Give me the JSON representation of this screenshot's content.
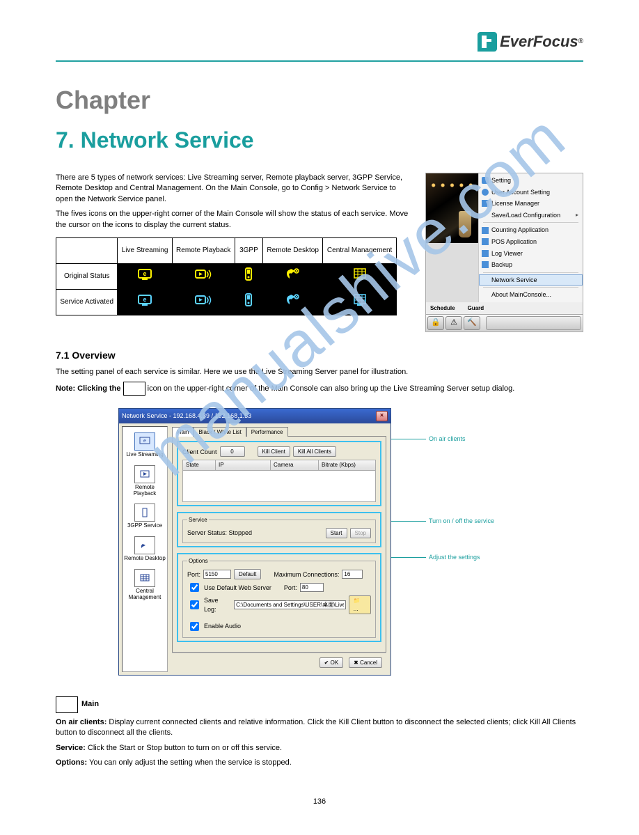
{
  "logo": {
    "brand": "EverFocus",
    "reg": "®"
  },
  "chapter_label": "Chapter",
  "chapter_title": "7. Network Service",
  "intro_para": "There are 5 types of network services: Live Streaming server, Remote playback server, 3GPP Service, Remote Desktop and Central Management. On the Main Console, go to Config > Network Service to open the Network Service panel.",
  "icon_explain": "The fives icons on the upper-right corner of the Main Console will show the status of each service. Move the cursor on the icons to display the current status.",
  "icon_table": {
    "cols": [
      "",
      "Live Streaming",
      "Remote Playback",
      "3GPP",
      "Remote Desktop",
      "Central Management"
    ],
    "rows": [
      {
        "label": "Original Status"
      },
      {
        "label": "Service Activated"
      }
    ]
  },
  "ctx": {
    "items": [
      "Setting",
      "User Account Setting",
      "License Manager",
      "Save/Load Configuration",
      "Counting Application",
      "POS Application",
      "Log Viewer",
      "Backup",
      "Network Service",
      "About MainConsole..."
    ],
    "tabs": [
      "Schedule",
      "Guard"
    ]
  },
  "overview": {
    "title": "7.1 Overview",
    "text": "The setting panel of each service is similar. Here we use the Live Streaming Server panel for illustration."
  },
  "note": "Note: Clicking the",
  "note2": "icon on the upper-right corner of the Main Console can also bring up the Live Streaming Server setup dialog.",
  "dialog": {
    "title": "Network Service - 192.168.4.39 / 192.168.1.53",
    "tabs": [
      "Main",
      "Black / White List",
      "Performance"
    ],
    "sidebar": [
      "Live Streaming",
      "Remote Playback",
      "3GPP Service",
      "Remote Desktop",
      "Central Management"
    ],
    "client_count_label": "Client Count",
    "client_count_value": "0",
    "kill_client": "Kill Client",
    "kill_all": "Kill All Clients",
    "cols": [
      "State",
      "IP",
      "Camera",
      "Bitrate (Kbps)"
    ],
    "service_legend": "Service",
    "server_status": "Server Status: Stopped",
    "start": "Start",
    "stop": "Stop",
    "options_legend": "Options",
    "port_label": "Port:",
    "port_value": "5150",
    "default": "Default",
    "max_conn_label": "Maximum Connections:",
    "max_conn_value": "16",
    "use_default_web": "Use Default Web Server",
    "port2_label": "Port:",
    "port2_value": "80",
    "save_log": "Save Log:",
    "save_log_path": "C:\\Documents and Settings\\USER\\桌面\\LiveServ",
    "browse": "...",
    "enable_audio": "Enable Audio",
    "ok": "OK",
    "cancel": "Cancel"
  },
  "callouts": {
    "a": "On air clients",
    "b": "Turn on / off the service",
    "c": "Adjust the settings"
  },
  "sections": {
    "main": {
      "head": "Main",
      "client": "On air clients: Display current connected clients and relative information. Click the Kill Client button to disconnect the selected clients; click Kill All Clients button to disconnect all the clients.",
      "service": "Service: Click the Start or Stop button to turn on or off this service.",
      "options": "Options: You can only adjust the setting when the service is stopped."
    }
  },
  "page_number": "136",
  "watermark": "manualshive.com"
}
